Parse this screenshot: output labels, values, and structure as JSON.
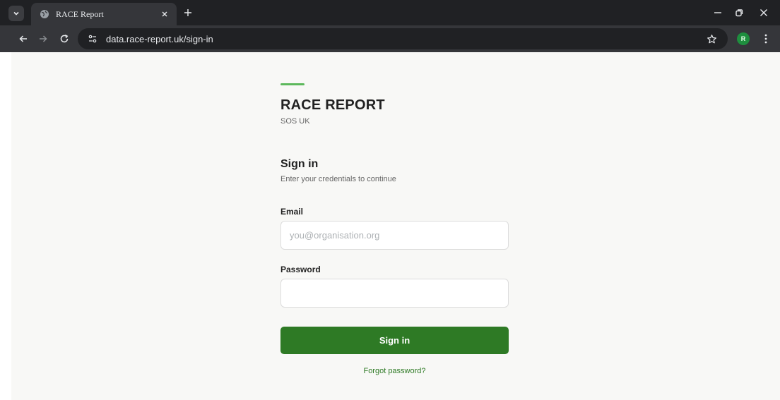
{
  "browser": {
    "tab_title": "RACE Report",
    "url": "data.race-report.uk/sign-in",
    "profile_initial": "R",
    "icons": {
      "tab_list": "chevron-down-icon",
      "favicon": "globe-icon",
      "tab_close": "close-icon",
      "new_tab": "plus-icon",
      "minimize": "minimize-icon",
      "restore": "restore-icon",
      "close_window": "close-icon",
      "back": "back-arrow-icon",
      "forward": "forward-arrow-icon",
      "reload": "reload-icon",
      "site_info": "tune-icon",
      "bookmark": "star-icon",
      "menu": "kebab-menu-icon"
    }
  },
  "brand": {
    "title": "RACE REPORT",
    "subtitle": "SOS UK",
    "accent_color": "#5cb85c"
  },
  "signin": {
    "heading": "Sign in",
    "subheading": "Enter your credentials to continue",
    "email_label": "Email",
    "email_placeholder": "you@organisation.org",
    "email_value": "",
    "password_label": "Password",
    "password_value": "",
    "submit_label": "Sign in",
    "forgot_label": "Forgot password?",
    "button_color": "#2e7a25"
  }
}
